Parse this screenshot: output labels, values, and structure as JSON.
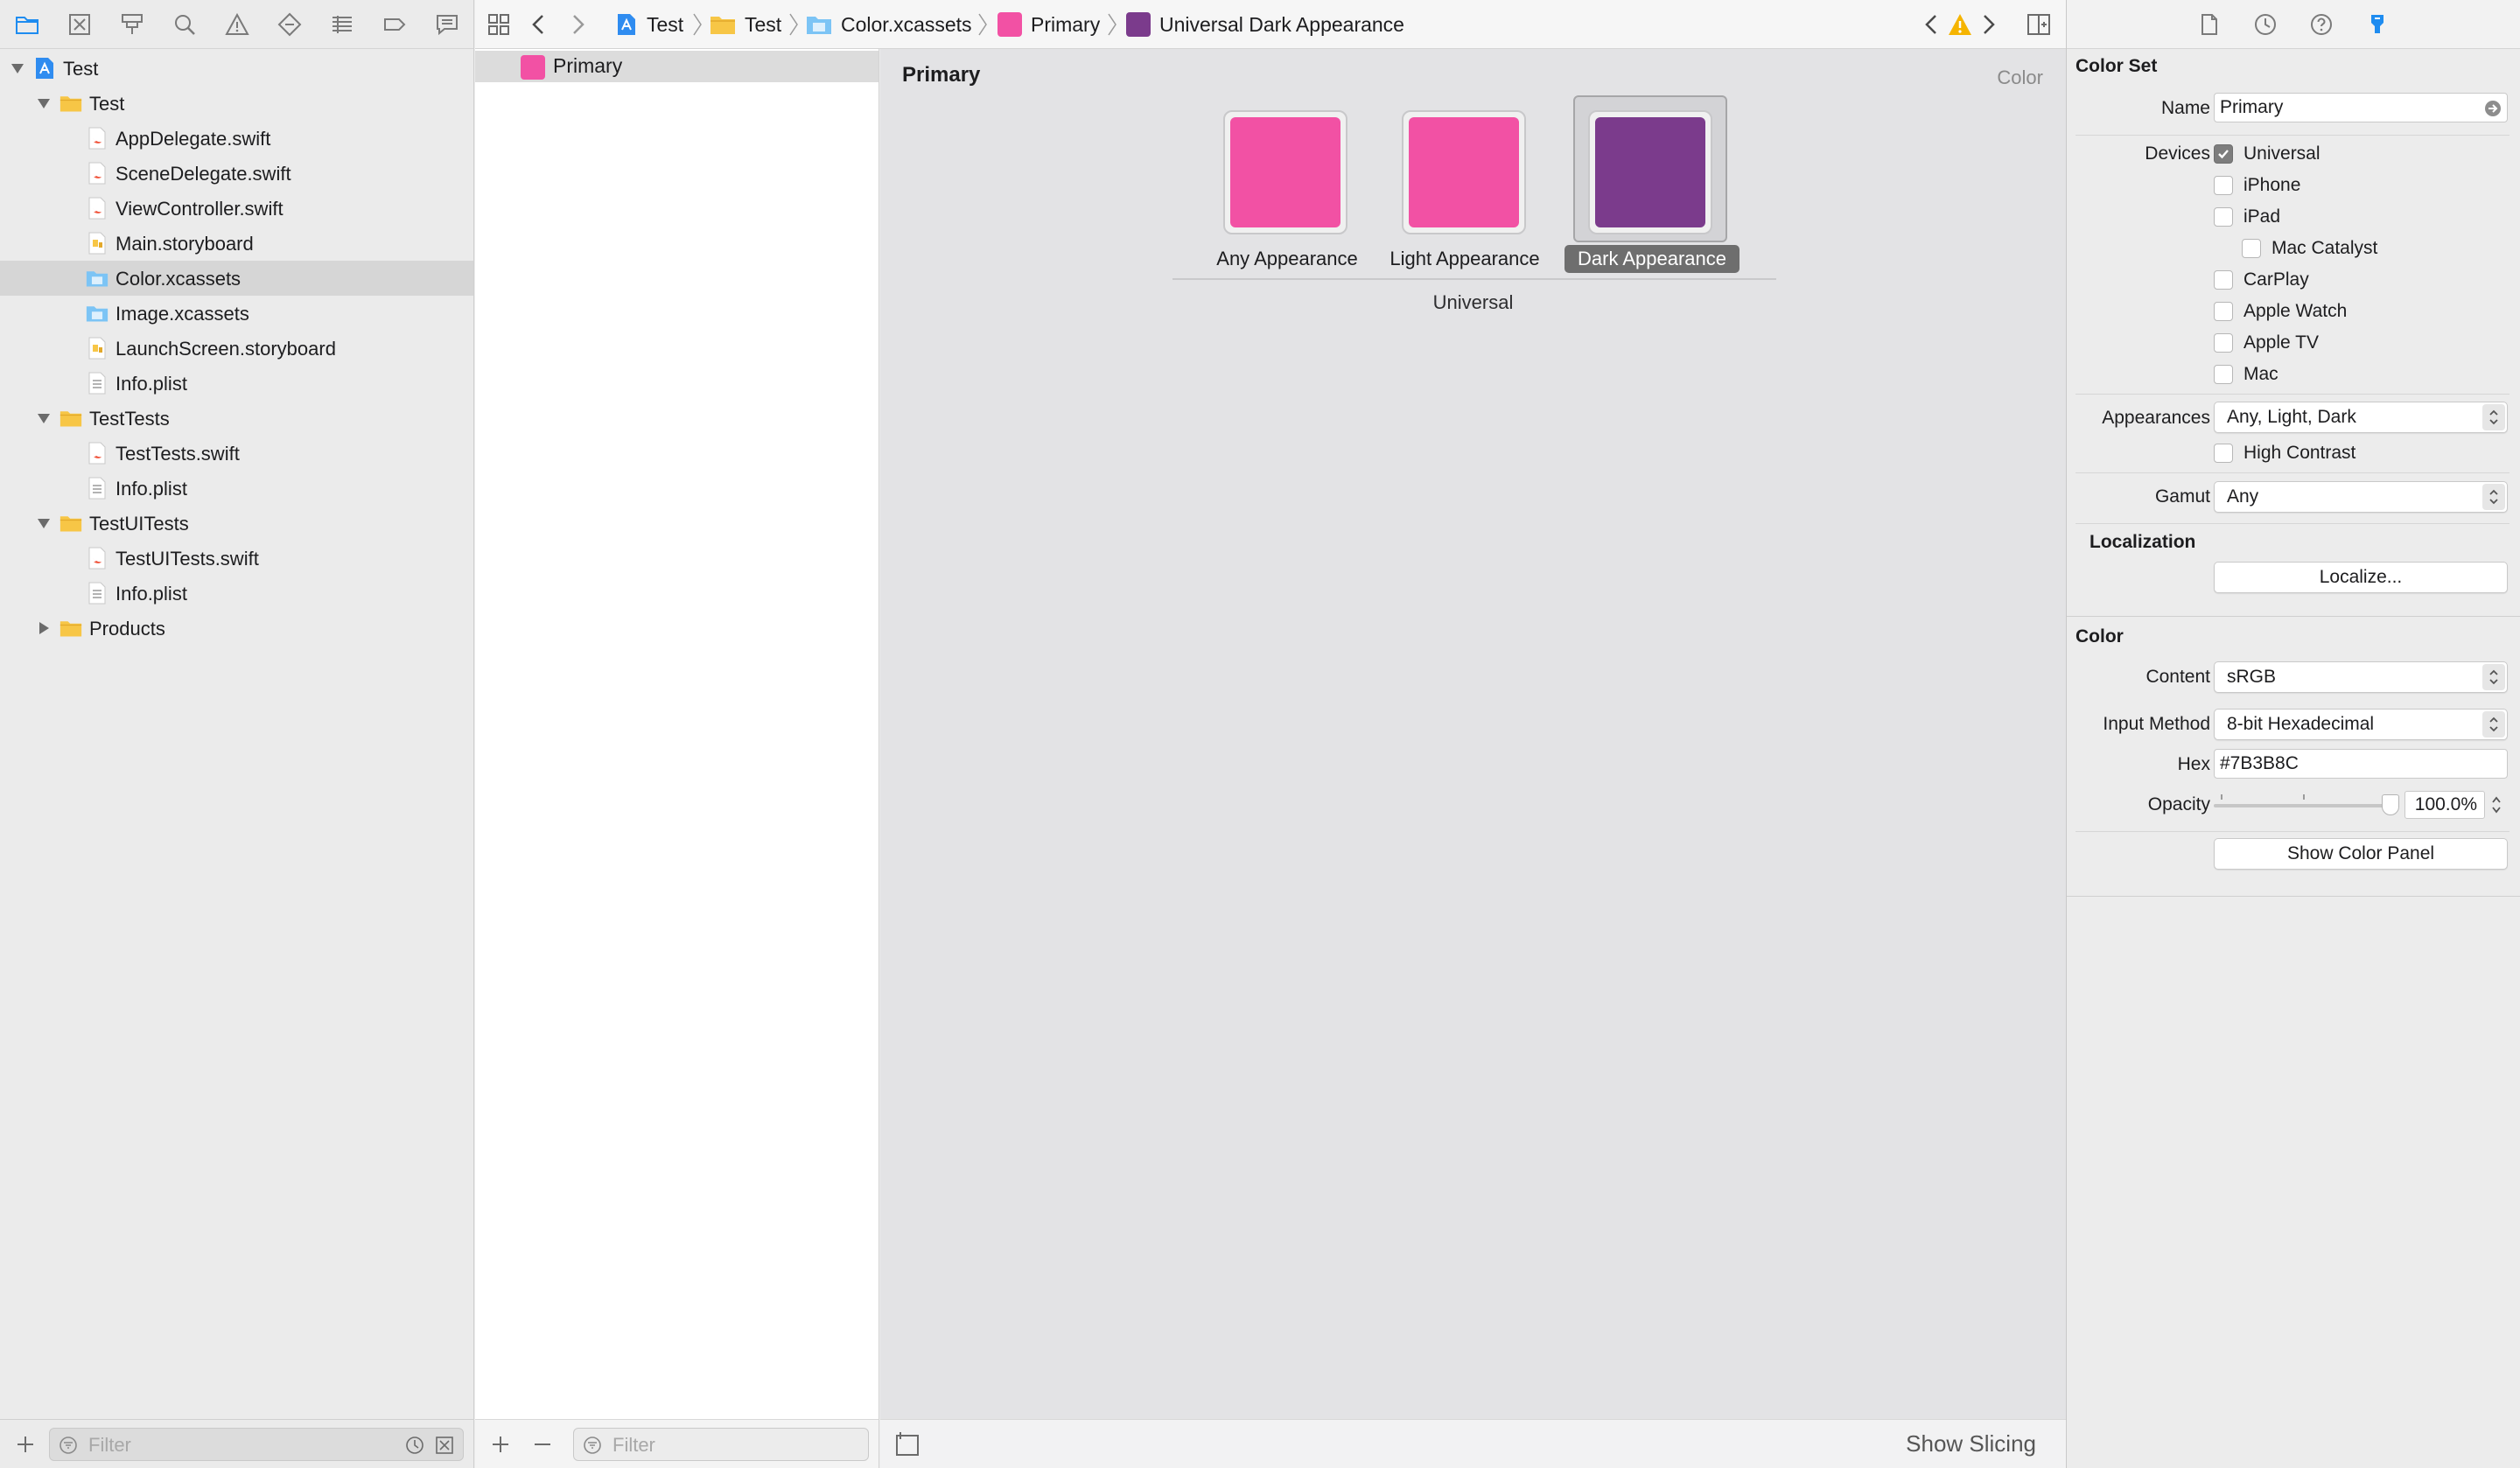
{
  "navigator": {
    "tree": [
      {
        "label": "Test",
        "kind": "project",
        "expanded": true
      },
      {
        "label": "Test",
        "kind": "folder",
        "expanded": true
      },
      {
        "label": "AppDelegate.swift",
        "kind": "swift"
      },
      {
        "label": "SceneDelegate.swift",
        "kind": "swift"
      },
      {
        "label": "ViewController.swift",
        "kind": "swift"
      },
      {
        "label": "Main.storyboard",
        "kind": "storyboard"
      },
      {
        "label": "Color.xcassets",
        "kind": "xcassets",
        "selected": true
      },
      {
        "label": "Image.xcassets",
        "kind": "xcassets"
      },
      {
        "label": "LaunchScreen.storyboard",
        "kind": "storyboard"
      },
      {
        "label": "Info.plist",
        "kind": "plist"
      },
      {
        "label": "TestTests",
        "kind": "folder",
        "expanded": true
      },
      {
        "label": "TestTests.swift",
        "kind": "swift"
      },
      {
        "label": "Info.plist",
        "kind": "plist"
      },
      {
        "label": "TestUITests",
        "kind": "folder",
        "expanded": true
      },
      {
        "label": "TestUITests.swift",
        "kind": "swift"
      },
      {
        "label": "Info.plist",
        "kind": "plist"
      },
      {
        "label": "Products",
        "kind": "folder",
        "expanded": false
      }
    ],
    "filter_placeholder": "Filter"
  },
  "jumpbar": {
    "items": [
      "Test",
      "Test",
      "Color.xcassets",
      "Primary",
      "Universal Dark Appearance"
    ]
  },
  "asset_list": {
    "items": [
      {
        "label": "Primary",
        "color": "#F251A4"
      }
    ],
    "filter_placeholder": "Filter"
  },
  "editor": {
    "title": "Primary",
    "kind": "Color",
    "wells": [
      {
        "label": "Any Appearance",
        "color": "#F251A4"
      },
      {
        "label": "Light Appearance",
        "color": "#F251A4"
      },
      {
        "label": "Dark Appearance",
        "color": "#7B3B8C",
        "selected": true
      }
    ],
    "group_label": "Universal",
    "show_slicing": "Show Slicing"
  },
  "inspector": {
    "color_set_title": "Color Set",
    "name_label": "Name",
    "name_value": "Primary",
    "devices_label": "Devices",
    "devices": [
      {
        "label": "Universal",
        "checked": true
      },
      {
        "label": "iPhone",
        "checked": false
      },
      {
        "label": "iPad",
        "checked": false
      },
      {
        "label": "Mac Catalyst",
        "checked": false
      },
      {
        "label": "CarPlay",
        "checked": false
      },
      {
        "label": "Apple Watch",
        "checked": false
      },
      {
        "label": "Apple TV",
        "checked": false
      },
      {
        "label": "Mac",
        "checked": false
      }
    ],
    "appearances_label": "Appearances",
    "appearances_value": "Any, Light, Dark",
    "high_contrast_label": "High Contrast",
    "gamut_label": "Gamut",
    "gamut_value": "Any",
    "localization_title": "Localization",
    "localize_button": "Localize...",
    "color_title": "Color",
    "content_label": "Content",
    "content_value": "sRGB",
    "input_method_label": "Input Method",
    "input_method_value": "8-bit Hexadecimal",
    "hex_label": "Hex",
    "hex_value": "#7B3B8C",
    "opacity_label": "Opacity",
    "opacity_value": "100.0%",
    "opacity_fraction": 1.0,
    "show_color_panel": "Show Color Panel"
  },
  "colors": {
    "accent_blue": "#1E8CF0",
    "swift_orange": "#F05138",
    "folder_yellow": "#F7C646",
    "primary_pink": "#F251A4",
    "primary_dark": "#7B3B8C",
    "warning_yellow": "#F5B400"
  }
}
